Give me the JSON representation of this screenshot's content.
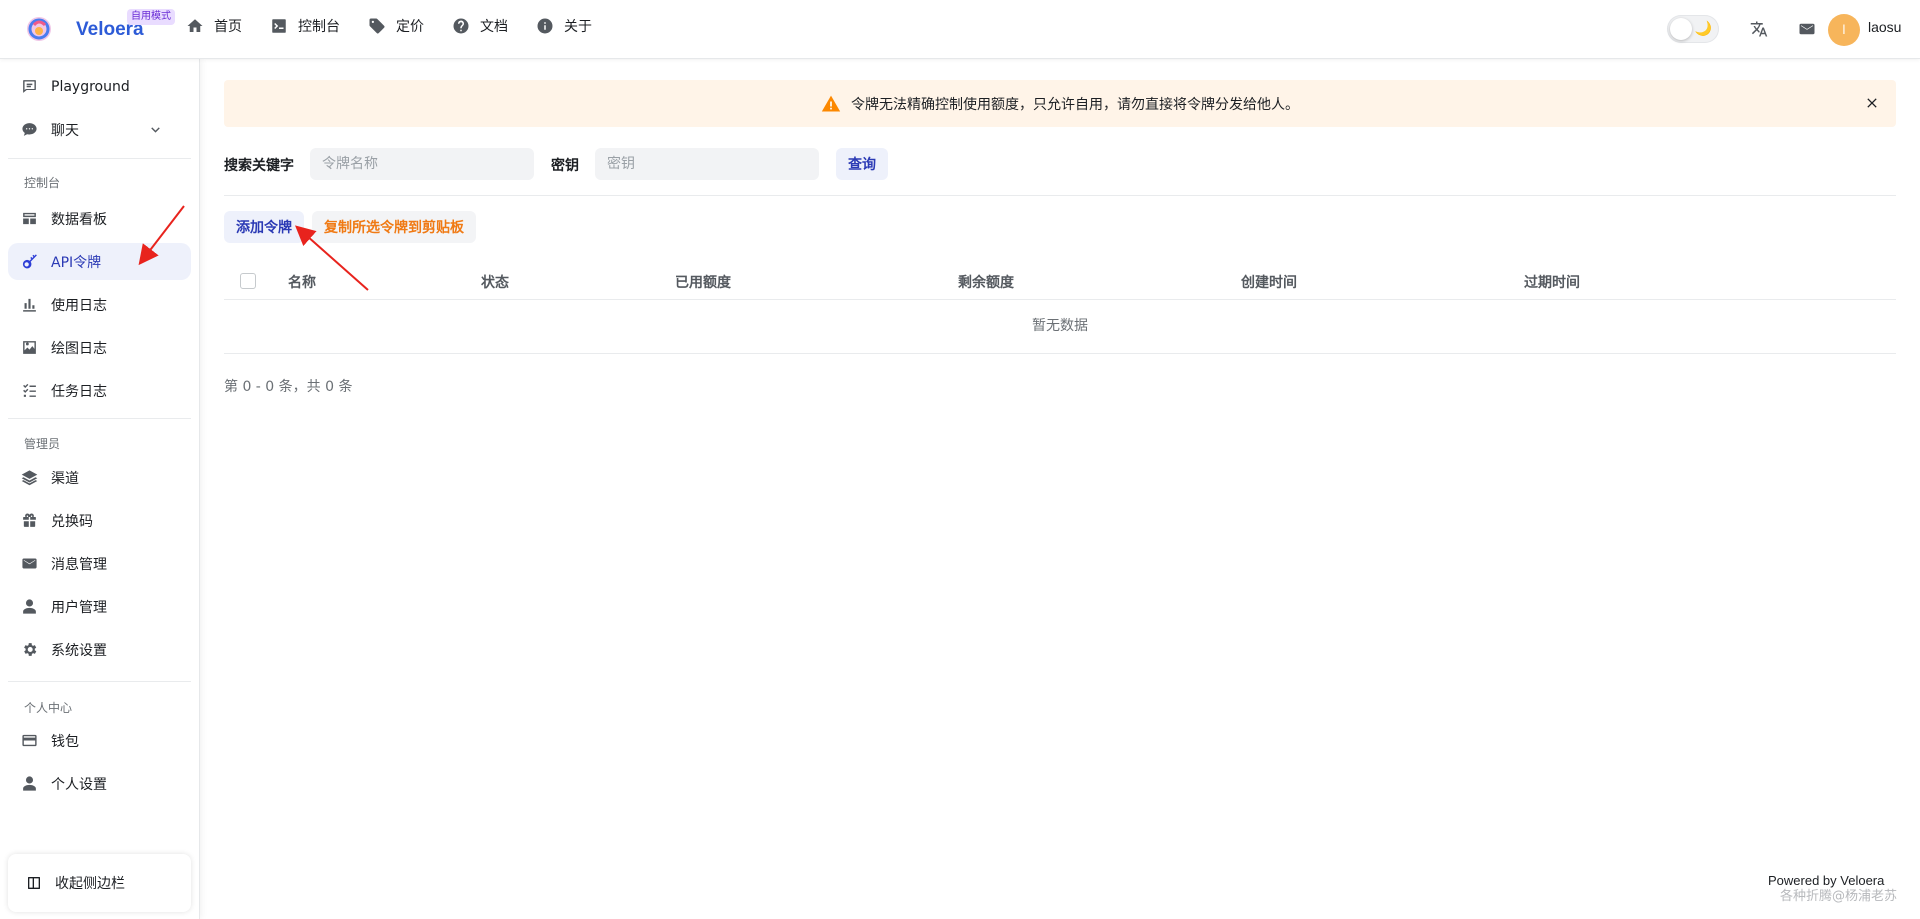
{
  "brand": {
    "name": "Veloera",
    "badge": "自用模式"
  },
  "topnav": {
    "items": [
      {
        "label": "首页",
        "icon": "home-icon"
      },
      {
        "label": "控制台",
        "icon": "terminal-icon"
      },
      {
        "label": "定价",
        "icon": "price-tag-icon"
      },
      {
        "label": "文档",
        "icon": "help-circle-icon"
      },
      {
        "label": "关于",
        "icon": "info-icon"
      }
    ]
  },
  "header": {
    "theme_icon": "🌙",
    "avatar_letter": "l",
    "username": "laosu"
  },
  "sidebar": {
    "playground": "Playground",
    "chat": "聊天",
    "group_console": "控制台",
    "dashboard": "数据看板",
    "api_token": "API令牌",
    "usage_log": "使用日志",
    "drawing_log": "绘图日志",
    "task_log": "任务日志",
    "group_admin": "管理员",
    "channel": "渠道",
    "redeem": "兑换码",
    "message": "消息管理",
    "user_mgmt": "用户管理",
    "system": "系统设置",
    "group_personal": "个人中心",
    "wallet": "钱包",
    "personal_settings": "个人设置",
    "collapse": "收起侧边栏"
  },
  "banner": {
    "text": "令牌无法精确控制使用额度，只允许自用，请勿直接将令牌分发给他人。"
  },
  "filter": {
    "keyword_label": "搜索关键字",
    "keyword_placeholder": "令牌名称",
    "key_label": "密钥",
    "key_placeholder": "密钥",
    "query_button": "查询"
  },
  "actions": {
    "add": "添加令牌",
    "copy": "复制所选令牌到剪贴板"
  },
  "table": {
    "columns": [
      "名称",
      "状态",
      "已用额度",
      "剩余额度",
      "创建时间",
      "过期时间"
    ],
    "empty": "暂无数据"
  },
  "pager": "第 0 - 0 条，共 0 条",
  "footer": "Powered by Veloera",
  "watermark": "各种折腾@杨浦老苏",
  "colors": {
    "accent": "#2d3ed6",
    "warning": "#f07a14",
    "banner_bg": "#fff4e8",
    "annotation": "#e8231d"
  }
}
